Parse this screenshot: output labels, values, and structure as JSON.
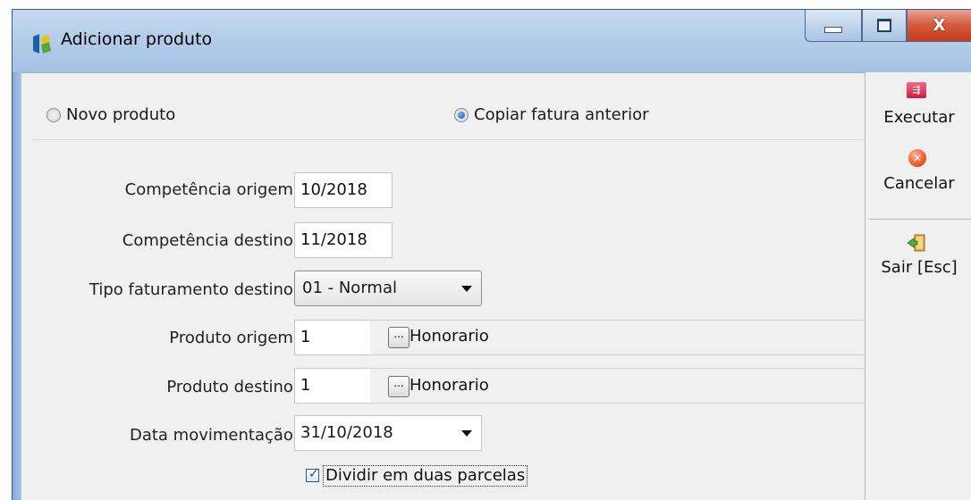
{
  "window": {
    "title": "Adicionar produto",
    "close_glyph": "X"
  },
  "mode": {
    "option_new": "Novo produto",
    "option_copy": "Copiar fatura anterior",
    "selected": "Copiar fatura anterior"
  },
  "form": {
    "comp_origem_label": "Competência origem:",
    "comp_origem_value": "10/2018",
    "comp_destino_label": "Competência destino:",
    "comp_destino_value": "11/2018",
    "tipo_label": "Tipo faturamento destino:",
    "tipo_value": "01 - Normal",
    "prod_origem_label": "Produto origem:",
    "prod_origem_value": "1",
    "prod_origem_name": "Honorario",
    "prod_destino_label": "Produto destino:",
    "prod_destino_value": "1",
    "prod_destino_name": "Honorario",
    "data_label": "Data movimentação:",
    "data_value": "31/10/2018",
    "dividir_label": "Dividir em duas parcelas",
    "dividir_checked": true,
    "ellipsis": "..."
  },
  "side": {
    "executar": "Executar",
    "cancelar": "Cancelar",
    "sair": "Sair [Esc]"
  },
  "icons": {
    "app": "app-logo-icon",
    "executar": "execute-icon",
    "cancelar": "cancel-icon",
    "sair": "exit-door-icon"
  }
}
